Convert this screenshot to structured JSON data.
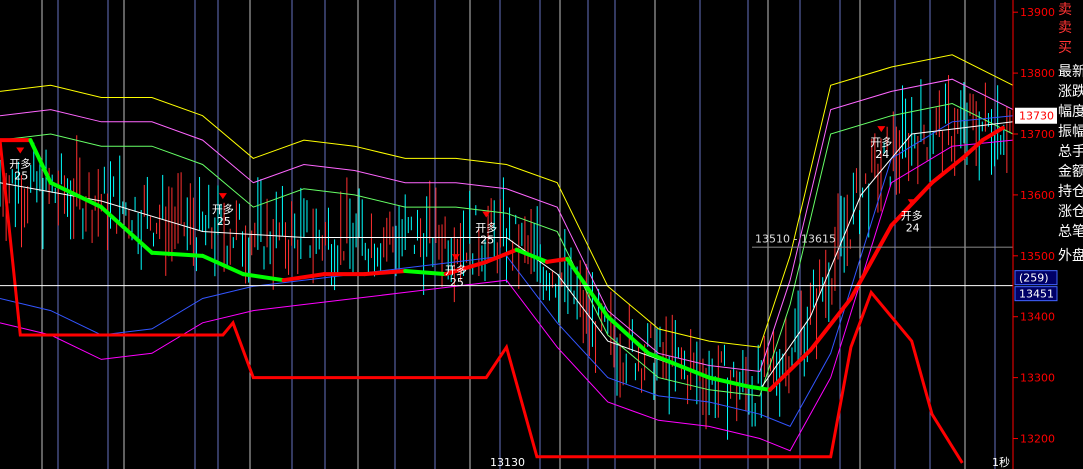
{
  "colors": {
    "background": "#000000",
    "up_candle": "#ff3030",
    "down_candle": "#00ffff",
    "bull_line": "#ff0000",
    "bear_line": "#00ff00",
    "axis": "#ff0000",
    "grid": "#ffffff"
  },
  "side_panel": {
    "labels": [
      "卖",
      "卖",
      "买",
      "最新",
      "涨跌",
      "幅度",
      "振幅",
      "总手",
      "金额",
      "持仓",
      "涨仓",
      "总笔",
      "外盘"
    ]
  },
  "chart_data": {
    "type": "line",
    "ylim": [
      13150,
      13920
    ],
    "y_ticks": [
      {
        "value": 13900,
        "label": "13900"
      },
      {
        "value": 13800,
        "label": "13800"
      },
      {
        "value": 13700,
        "label": "13700"
      },
      {
        "value": 13600,
        "label": "13600"
      },
      {
        "value": 13500,
        "label": "13500"
      },
      {
        "value": 13400,
        "label": "13400"
      },
      {
        "value": 13300,
        "label": "13300"
      },
      {
        "value": 13200,
        "label": "13200"
      }
    ],
    "last_price": {
      "value": 13730,
      "label": "13730"
    },
    "crosshair": {
      "value": 13451,
      "label": "13451",
      "bar_label": "(259)"
    },
    "low_marker": {
      "value": 13130,
      "label": "13130"
    },
    "range_text": "13510 - 13615",
    "period_label": "1秒",
    "series": [
      {
        "role": "trend",
        "color": "#ff0000",
        "points": [
          [
            0,
            13690
          ],
          [
            3,
            13690
          ],
          [
            5,
            13620
          ],
          [
            10,
            13580
          ],
          [
            15,
            13505
          ],
          [
            20,
            13500
          ],
          [
            24,
            13470
          ],
          [
            28,
            13460
          ],
          [
            32,
            13470
          ],
          [
            36,
            13470
          ],
          [
            40,
            13475
          ],
          [
            44,
            13470
          ],
          [
            48,
            13490
          ],
          [
            51,
            13510
          ],
          [
            54,
            13490
          ],
          [
            56,
            13495
          ],
          [
            60,
            13400
          ],
          [
            64,
            13340
          ],
          [
            70,
            13300
          ],
          [
            74,
            13285
          ],
          [
            76,
            13280
          ],
          [
            80,
            13345
          ],
          [
            84,
            13430
          ],
          [
            88,
            13550
          ],
          [
            92,
            13620
          ],
          [
            95,
            13660
          ],
          [
            97,
            13690
          ],
          [
            99,
            13710
          ]
        ]
      },
      {
        "role": "stop",
        "color": "#ff0000",
        "points": [
          [
            0,
            13690
          ],
          [
            2,
            13370
          ],
          [
            22,
            13370
          ],
          [
            23,
            13390
          ],
          [
            25,
            13300
          ],
          [
            48,
            13300
          ],
          [
            50,
            13350
          ],
          [
            53,
            13170
          ],
          [
            82,
            13170
          ],
          [
            84,
            13350
          ],
          [
            86,
            13440
          ],
          [
            88,
            13400
          ],
          [
            90,
            13360
          ],
          [
            92,
            13240
          ],
          [
            95,
            13160
          ]
        ]
      },
      {
        "role": "band-upper",
        "color": "#ffff00",
        "points": [
          [
            0,
            13770
          ],
          [
            5,
            13780
          ],
          [
            10,
            13760
          ],
          [
            15,
            13760
          ],
          [
            20,
            13730
          ],
          [
            25,
            13660
          ],
          [
            30,
            13690
          ],
          [
            35,
            13680
          ],
          [
            40,
            13660
          ],
          [
            45,
            13660
          ],
          [
            50,
            13650
          ],
          [
            55,
            13620
          ],
          [
            60,
            13450
          ],
          [
            65,
            13380
          ],
          [
            70,
            13360
          ],
          [
            75,
            13350
          ],
          [
            78,
            13500
          ],
          [
            82,
            13780
          ],
          [
            88,
            13810
          ],
          [
            94,
            13830
          ],
          [
            100,
            13780
          ]
        ]
      },
      {
        "role": "band-lower",
        "color": "#ff00ff",
        "points": [
          [
            0,
            13390
          ],
          [
            5,
            13370
          ],
          [
            10,
            13330
          ],
          [
            15,
            13340
          ],
          [
            20,
            13390
          ],
          [
            25,
            13410
          ],
          [
            30,
            13420
          ],
          [
            35,
            13430
          ],
          [
            40,
            13440
          ],
          [
            45,
            13450
          ],
          [
            50,
            13460
          ],
          [
            55,
            13350
          ],
          [
            60,
            13260
          ],
          [
            65,
            13230
          ],
          [
            70,
            13220
          ],
          [
            75,
            13200
          ],
          [
            78,
            13180
          ],
          [
            82,
            13300
          ],
          [
            88,
            13620
          ],
          [
            94,
            13680
          ],
          [
            100,
            13690
          ]
        ]
      },
      {
        "role": "mid",
        "color": "#ffffff",
        "points": [
          [
            0,
            13620
          ],
          [
            10,
            13590
          ],
          [
            20,
            13540
          ],
          [
            30,
            13530
          ],
          [
            40,
            13530
          ],
          [
            50,
            13530
          ],
          [
            55,
            13470
          ],
          [
            60,
            13360
          ],
          [
            70,
            13300
          ],
          [
            75,
            13280
          ],
          [
            80,
            13400
          ],
          [
            85,
            13600
          ],
          [
            90,
            13700
          ],
          [
            100,
            13720
          ]
        ]
      }
    ],
    "annotations": [
      {
        "x": 2,
        "y": 13645,
        "text": "开多",
        "sub": "25",
        "color": "#ffffff"
      },
      {
        "x": 22,
        "y": 13570,
        "text": "开多",
        "sub": "25",
        "color": "#ffffff"
      },
      {
        "x": 45,
        "y": 13470,
        "text": "开多",
        "sub": "25",
        "color": "#ffffff"
      },
      {
        "x": 48,
        "y": 13540,
        "text": "开多",
        "sub": "25",
        "color": "#ffffff"
      },
      {
        "x": 87,
        "y": 13680,
        "text": "开多",
        "sub": "24",
        "color": "#ffffff"
      },
      {
        "x": 90,
        "y": 13560,
        "text": "开多",
        "sub": "24",
        "color": "#ffffff"
      }
    ]
  }
}
